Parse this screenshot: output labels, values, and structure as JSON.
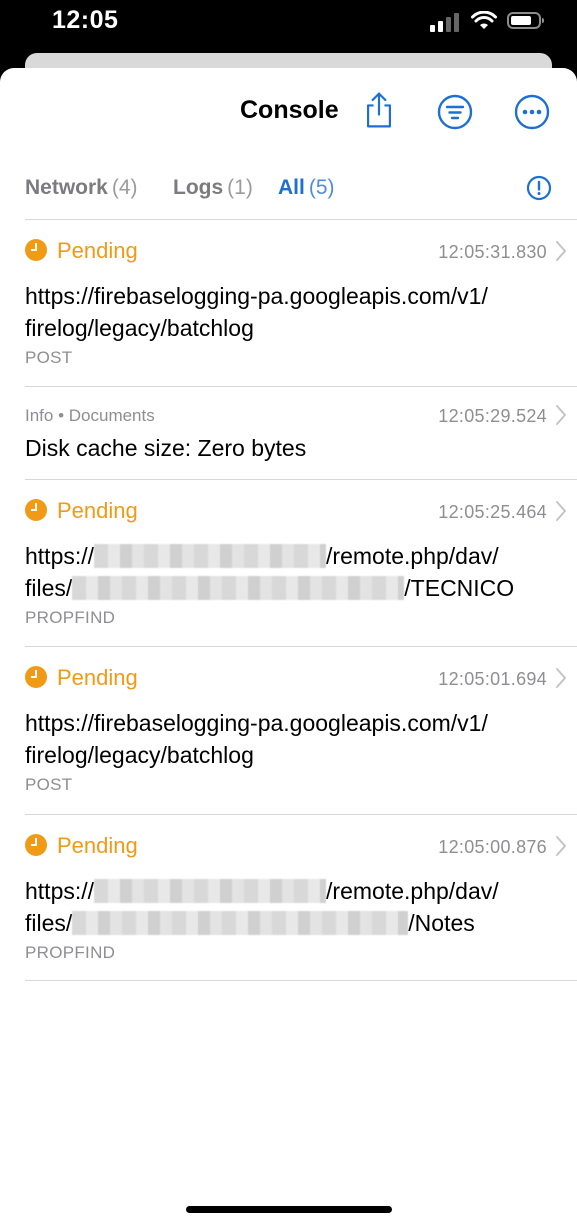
{
  "status_bar": {
    "time": "12:05"
  },
  "header": {
    "title": "Console",
    "share_icon": "share-icon",
    "filter_icon": "filter-icon",
    "more_icon": "more-icon"
  },
  "tabs": [
    {
      "label": "Network",
      "count": "(4)",
      "active": false
    },
    {
      "label": "Logs",
      "count": "(1)",
      "active": false
    },
    {
      "label": "All",
      "count": "(5)",
      "active": true
    }
  ],
  "entries": [
    {
      "kind": "network",
      "status": "Pending",
      "timestamp": "12:05:31.830",
      "url_line1": "https://firebaselogging-pa.googleapis.com/v1/",
      "url_line2": "firelog/legacy/batchlog",
      "method": "POST"
    },
    {
      "kind": "log",
      "category": "Info • Documents",
      "timestamp": "12:05:29.524",
      "message": "Disk cache size: Zero bytes"
    },
    {
      "kind": "network-redacted",
      "status": "Pending",
      "timestamp": "12:05:25.464",
      "url_line1_prefix": "https://",
      "url_line1_suffix": "/remote.php/dav/",
      "url_line2_prefix": "files/",
      "url_line2_suffix": "/TECNICO",
      "method": "PROPFIND"
    },
    {
      "kind": "network",
      "status": "Pending",
      "timestamp": "12:05:01.694",
      "url_line1": "https://firebaselogging-pa.googleapis.com/v1/",
      "url_line2": "firelog/legacy/batchlog",
      "method": "POST"
    },
    {
      "kind": "network-redacted",
      "status": "Pending",
      "timestamp": "12:05:00.876",
      "url_line1_prefix": "https://",
      "url_line1_suffix": "/remote.php/dav/",
      "url_line2_prefix": "files/",
      "url_line2_suffix": "/Notes",
      "method": "PROPFIND"
    }
  ],
  "colors": {
    "pending": "#f09a16",
    "accent": "#1d6fd2",
    "secondary_text": "#8e8e93"
  }
}
